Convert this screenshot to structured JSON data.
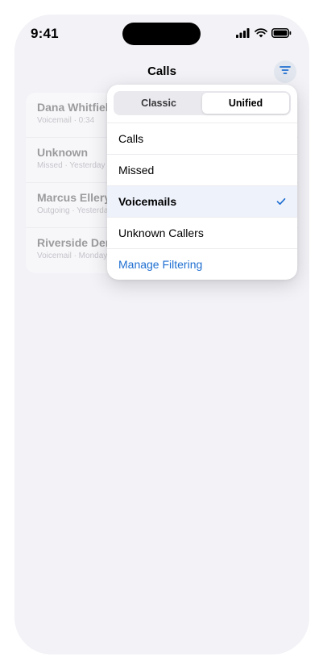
{
  "status": {
    "time": "9:41",
    "icons": [
      "signal-icon",
      "wifi-icon",
      "battery-icon"
    ]
  },
  "nav": {
    "title": "Calls",
    "filter_icon": "filter-icon"
  },
  "calls": [
    {
      "name": "Dana Whitfield",
      "detail": "Voicemail · 0:34"
    },
    {
      "name": "Unknown",
      "detail": "Missed · Yesterday"
    },
    {
      "name": "Marcus Ellery",
      "detail": "Outgoing · Yesterday"
    },
    {
      "name": "Riverside Dental",
      "detail": "Voicemail · Monday"
    }
  ],
  "menu": {
    "segments": [
      {
        "label": "Classic",
        "active": false
      },
      {
        "label": "Unified",
        "active": true
      }
    ],
    "items": [
      {
        "label": "Calls"
      },
      {
        "label": "Missed"
      },
      {
        "label": "Voicemails",
        "selected": true
      },
      {
        "label": "Unknown Callers"
      }
    ],
    "link": "Manage Filtering"
  },
  "colors": {
    "accent": "#1f6fd1",
    "background": "#f2f2f7",
    "selected_row": "#eef2fb"
  }
}
